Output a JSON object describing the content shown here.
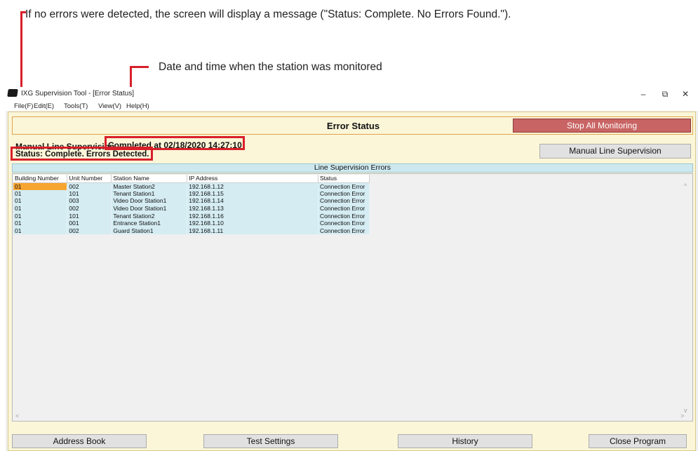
{
  "annotations": {
    "no_errors_note": "If no errors were detected, the screen will display a message (\"Status: Complete. No Errors Found.\").",
    "datetime_note": "Date and time when the station was monitored"
  },
  "window": {
    "title": "IXG Supervision Tool - [Error Status]",
    "controls": {
      "minimize": "–",
      "restore": "⧉",
      "close": "✕"
    }
  },
  "menu": [
    "File(F)",
    "Edit(E)",
    "Tools(T)",
    "View(V)",
    "Help(H)"
  ],
  "header": {
    "title": "Error Status",
    "stop_button": "Stop All Monitoring"
  },
  "supervision": {
    "label": "Manual Line Supervision",
    "completed": "Completed at 02/18/2020 14:27:10",
    "status": "Status: Complete. Errors Detected.",
    "button": "Manual Line Supervision"
  },
  "errors": {
    "section_title": "Line Supervision Errors",
    "columns": [
      "Building Number",
      "Unit Number",
      "Station Name",
      "IP Address",
      "Status"
    ],
    "rows": [
      [
        "01",
        "002",
        "Master Station2",
        "192.168.1.12",
        "Connection Error"
      ],
      [
        "01",
        "101",
        "Tenant Station1",
        "192.168.1.15",
        "Connection Error"
      ],
      [
        "01",
        "003",
        "Video Door Station1",
        "192.168.1.14",
        "Connection Error"
      ],
      [
        "01",
        "002",
        "Video Door Station1",
        "192.168.1.13",
        "Connection Error"
      ],
      [
        "01",
        "101",
        "Tenant Station2",
        "192.168.1.16",
        "Connection Error"
      ],
      [
        "01",
        "001",
        "Entrance Station1",
        "192.168.1.10",
        "Connection Error"
      ],
      [
        "01",
        "002",
        "Guard Station1",
        "192.168.1.11",
        "Connection Error"
      ]
    ]
  },
  "footer": {
    "address_book": "Address Book",
    "test_settings": "Test Settings",
    "history": "History",
    "close_program": "Close Program"
  },
  "colors": {
    "annotation_red": "#d8202a",
    "stop_button": "#c96464",
    "selected_cell": "#f7a531",
    "row_bg": "#d4ecf2"
  }
}
